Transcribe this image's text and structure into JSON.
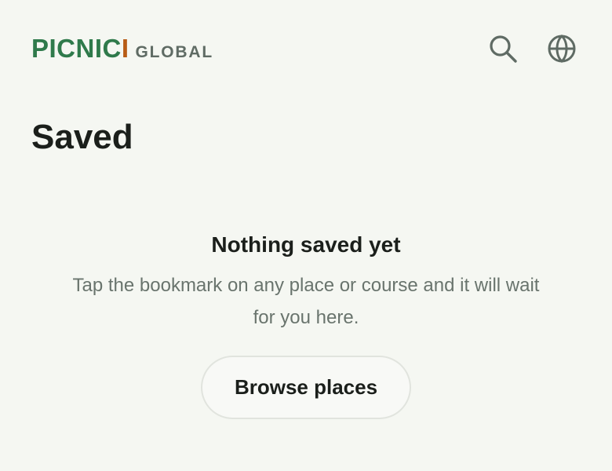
{
  "header": {
    "logo": {
      "main": "PICNIC",
      "accent": "I",
      "region": "GLOBAL"
    },
    "actions": [
      {
        "name": "search",
        "icon": "search-icon"
      },
      {
        "name": "language",
        "icon": "globe-icon"
      }
    ]
  },
  "page": {
    "title": "Saved"
  },
  "empty_state": {
    "title": "Nothing saved yet",
    "message": "Tap the bookmark on any place or course and it will wait for you here.",
    "button_label": "Browse places"
  },
  "colors": {
    "brand_green": "#2f7a4b",
    "brand_orange": "#b85c16",
    "background": "#f5f7f2",
    "text_primary": "#1b1f1b",
    "text_muted": "#69746d"
  }
}
